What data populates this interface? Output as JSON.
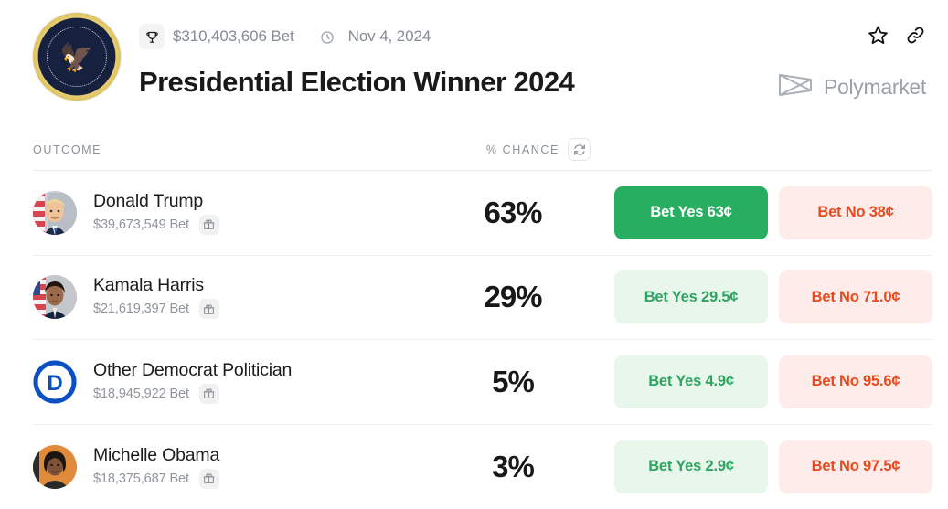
{
  "header": {
    "seal_icon": "presidential-seal",
    "trophy_icon": "trophy-icon",
    "volume": "$310,403,606 Bet",
    "clock_icon": "clock-icon",
    "date": "Nov 4, 2024",
    "title": "Presidential Election Winner 2024",
    "star_icon": "star-icon",
    "link_icon": "link-icon",
    "brand": "Polymarket",
    "brand_logo_icon": "polymarket-logo-icon"
  },
  "table": {
    "col_outcome": "OUTCOME",
    "col_chance": "% CHANCE",
    "refresh_icon": "refresh-icon",
    "gift_icon": "gift-icon",
    "rows": [
      {
        "name": "Donald Trump",
        "volume": "$39,673,549 Bet",
        "chance": "63%",
        "yes_label": "Bet Yes 63¢",
        "no_label": "Bet No 38¢",
        "yes_state": "active",
        "no_state": "default",
        "avatar": "donald-trump-avatar"
      },
      {
        "name": "Kamala Harris",
        "volume": "$21,619,397 Bet",
        "chance": "29%",
        "yes_label": "Bet Yes 29.5¢",
        "no_label": "Bet No 71.0¢",
        "yes_state": "default",
        "no_state": "default",
        "avatar": "kamala-harris-avatar"
      },
      {
        "name": "Other Democrat Politician",
        "volume": "$18,945,922 Bet",
        "chance": "5%",
        "yes_label": "Bet Yes 4.9¢",
        "no_label": "Bet No 95.6¢",
        "yes_state": "default",
        "no_state": "default",
        "avatar": "democratic-party-logo-avatar"
      },
      {
        "name": "Michelle Obama",
        "volume": "$18,375,687 Bet",
        "chance": "3%",
        "yes_label": "Bet Yes 2.9¢",
        "no_label": "Bet No 97.5¢",
        "yes_state": "default",
        "no_state": "default",
        "avatar": "michelle-obama-avatar"
      }
    ]
  },
  "colors": {
    "yes_accent": "#27ae60",
    "no_accent": "#e8491f",
    "yes_bg": "#e8f6ec",
    "no_bg": "#fdecea",
    "text": "#18191b",
    "muted": "#8f959b"
  }
}
